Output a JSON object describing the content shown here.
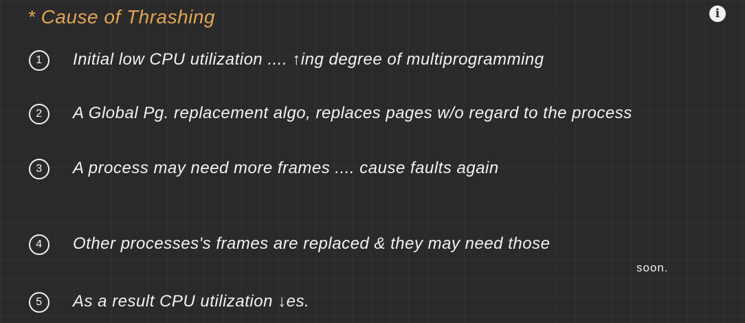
{
  "title": "* Cause of Thrashing",
  "info_icon": "i",
  "points": [
    {
      "num": "1",
      "text": "Initial low CPU utilization .... ↑ing degree of multiprogramming"
    },
    {
      "num": "2",
      "text": "A Global Pg. replacement algo, replaces pages w/o regard to the process"
    },
    {
      "num": "3",
      "text": "A process may need more frames .... cause faults again"
    },
    {
      "num": "4",
      "text": "Other processes's frames are replaced & they may need those"
    },
    {
      "num": "5",
      "text": "As a result CPU utilization ↓es."
    }
  ],
  "point4_continuation": "soon."
}
